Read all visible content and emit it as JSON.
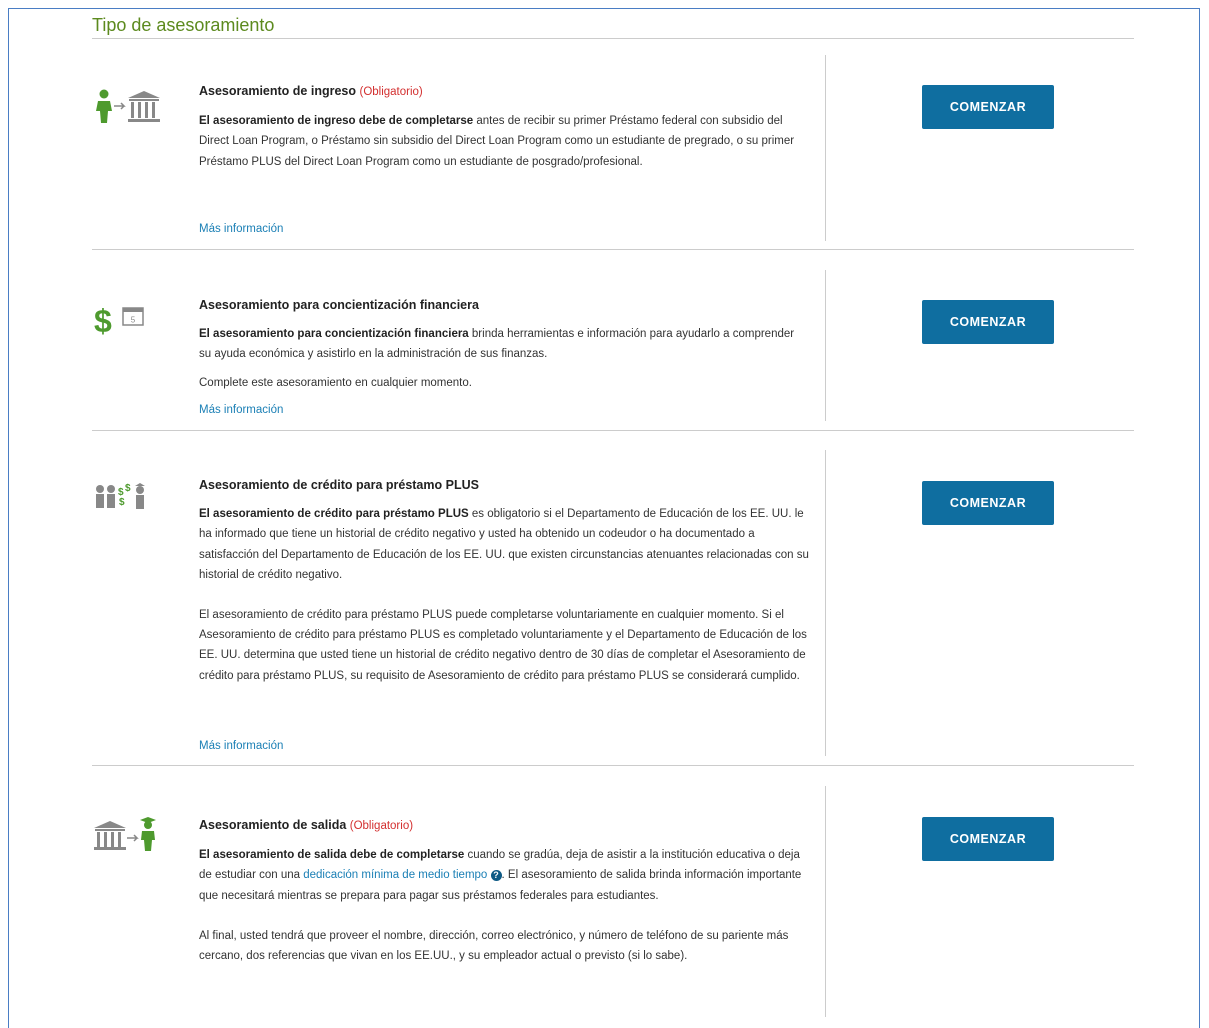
{
  "page": {
    "title": "Tipo de asesoramiento"
  },
  "button_label": "COMENZAR",
  "more_info": "Más información",
  "sections": [
    {
      "title": "Asesoramiento de ingreso",
      "required": "(Obligatorio)",
      "p1_bold": "El asesoramiento de ingreso debe de completarse",
      "p1_rest": " antes de recibir su primer Préstamo federal con subsidio del Direct Loan Program, o Préstamo sin subsidio del Direct Loan Program como un estudiante de pregrado, o su primer Préstamo PLUS del Direct Loan Program como un estudiante de posgrado/profesional.",
      "icon": "student-to-school-icon"
    },
    {
      "title": "Asesoramiento para concientización financiera",
      "p1_bold": "El asesoramiento para concientización financiera",
      "p1_rest": " brinda herramientas e información para ayudarlo a comprender su ayuda económica y asistirlo en la administración de sus finanzas.",
      "p2": "Complete este asesoramiento en cualquier momento.",
      "calendar_day": "5",
      "icon": "dollar-calendar-icon"
    },
    {
      "title": "Asesoramiento de crédito para préstamo PLUS",
      "p1_bold": "El asesoramiento de crédito para préstamo PLUS",
      "p1_rest": " es obligatorio si el Departamento de Educación de los EE. UU. le ha informado que tiene un historial de crédito negativo y usted ha obtenido un codeudor o ha documentado a satisfacción del Departamento de Educación de los EE. UU. que existen circunstancias atenuantes relacionadas con su historial de crédito negativo.",
      "p2": "El asesoramiento de crédito para préstamo PLUS puede completarse voluntariamente en cualquier momento. Si el Asesoramiento de crédito para préstamo PLUS es completado voluntariamente y el Departamento de Educación de los EE. UU. determina que usted tiene un historial de crédito negativo dentro de 30 días de completar el Asesoramiento de crédito para préstamo PLUS, su requisito de Asesoramiento de crédito para préstamo PLUS se considerará cumplido.",
      "icon": "family-money-icon"
    },
    {
      "title": "Asesoramiento de salida",
      "required": "(Obligatorio)",
      "p1_bold": "El asesoramiento de salida debe de completarse",
      "p1_rest_a": " cuando se gradúa, deja de asistir a la institución educativa o deja de estudiar con una ",
      "p1_link": "dedicación mínima de medio tiempo",
      "help_glyph": "?",
      "p1_rest_b": ". El asesoramiento de salida brinda información importante que necesitará mientras se prepara para pagar sus préstamos federales para estudiantes.",
      "p2": "Al final, usted tendrá que proveer el nombre, dirección, correo electrónico, y número de teléfono de su pariente más cercano, dos referencias que vivan en los EE.UU., y su empleador actual o previsto (si lo sabe).",
      "icon": "school-to-graduate-icon"
    }
  ],
  "colors": {
    "title_green": "#5c8a1e",
    "button_blue": "#0f6ea0",
    "link_blue": "#1a7fb5",
    "required_red": "#d32f2f",
    "icon_green": "#4e9a2e"
  }
}
